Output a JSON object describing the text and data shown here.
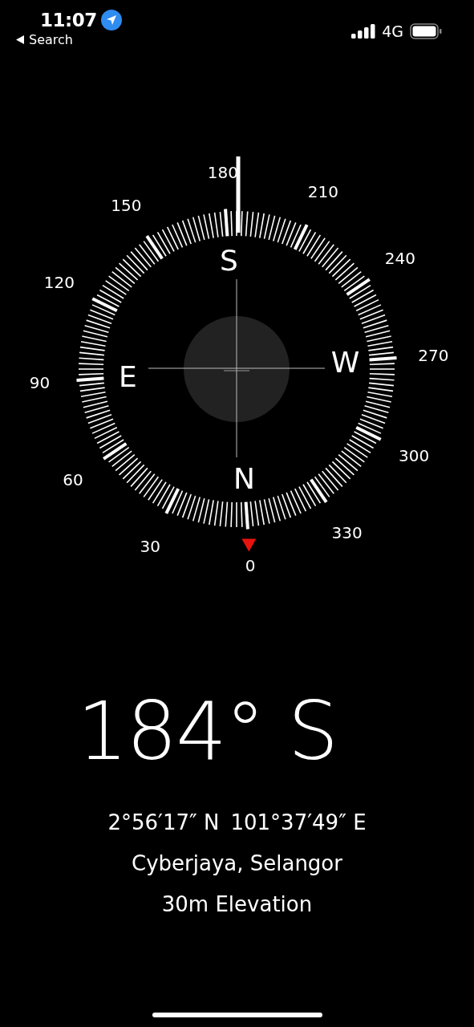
{
  "status_bar": {
    "time": "11:07",
    "back_label": "Search",
    "network": "4G"
  },
  "compass": {
    "degree_labels": [
      "0",
      "30",
      "60",
      "90",
      "120",
      "150",
      "180",
      "210",
      "240",
      "270",
      "300",
      "330"
    ],
    "cardinals": [
      "N",
      "E",
      "S",
      "W"
    ]
  },
  "heading": "184° S",
  "coordinates": {
    "latitude": "2°56′17″ N",
    "longitude": "101°37′49″ E"
  },
  "location": "Cyberjaya, Selangor",
  "elevation": "30m Elevation"
}
